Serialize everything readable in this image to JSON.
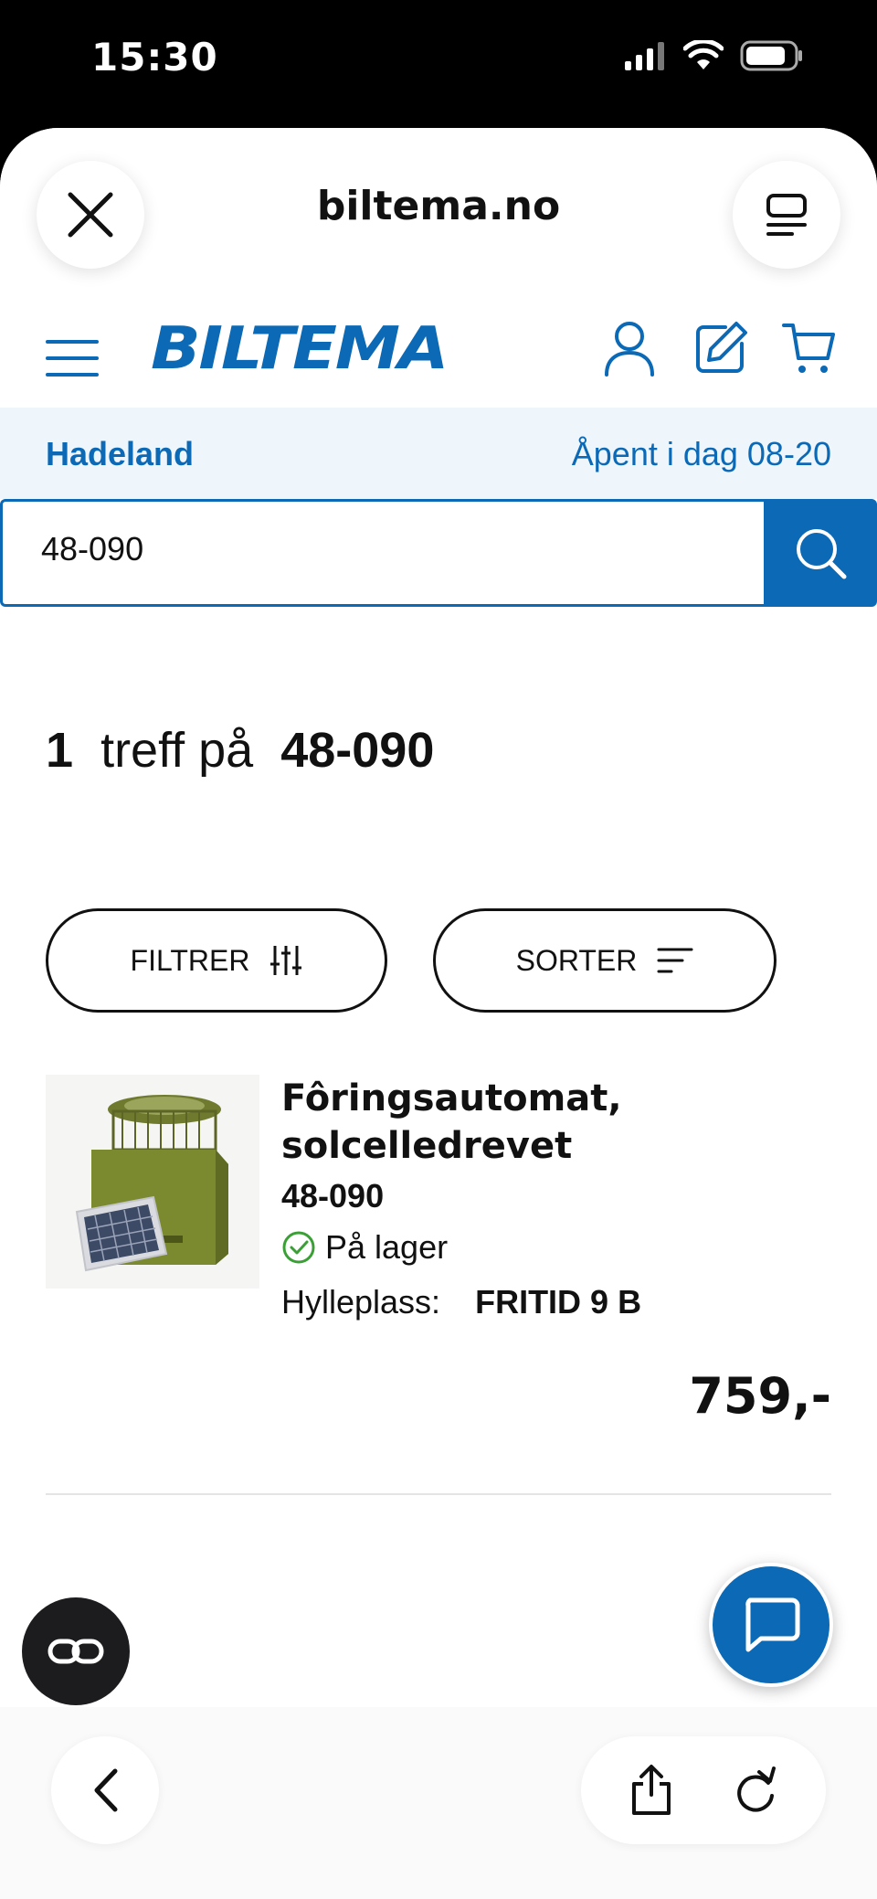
{
  "status_bar": {
    "time": "15:30"
  },
  "browser": {
    "url": "biltema.no",
    "close_icon": "close-icon",
    "tabs_icon": "tabs-icon"
  },
  "site": {
    "logo": "BILTEMA",
    "colors": {
      "brand": "#0b69b5",
      "store_bar_bg": "#eef5fb",
      "stock_green": "#3aa035"
    },
    "store": {
      "name": "Hadeland",
      "hours": "Åpent i dag 08-20"
    }
  },
  "search": {
    "value": "48-090"
  },
  "results": {
    "count": "1",
    "text": "treff på",
    "query": "48-090"
  },
  "controls": {
    "filter_label": "FILTRER",
    "sort_label": "SORTER"
  },
  "product": {
    "title_line1": "Fôringsautomat,",
    "title_line2": "solcelledrevet",
    "sku": "48-090",
    "stock": "På lager",
    "shelf_label": "Hylleplass:",
    "shelf_value": "FRITID 9 B",
    "price": "759,-"
  }
}
